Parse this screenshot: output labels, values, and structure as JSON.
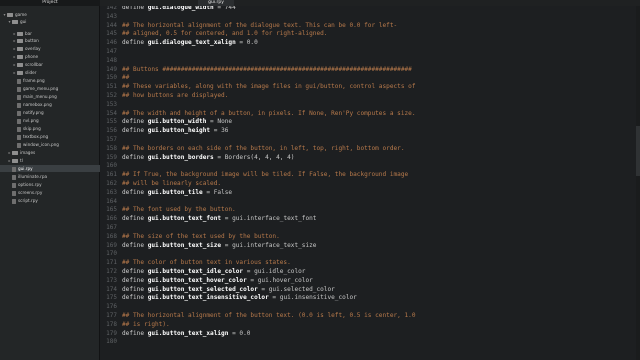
{
  "window": {
    "project_title": "Project",
    "active_tab": "gui.rpy"
  },
  "sidebar": {
    "items": [
      {
        "label": "game",
        "kind": "folder",
        "depth": 0,
        "expanded": true
      },
      {
        "label": "gui",
        "kind": "folder",
        "depth": 1,
        "expanded": true
      },
      {
        "label": "bar",
        "kind": "folder",
        "depth": 2,
        "expanded": false
      },
      {
        "label": "button",
        "kind": "folder",
        "depth": 2,
        "expanded": false
      },
      {
        "label": "overlay",
        "kind": "folder",
        "depth": 2,
        "expanded": false
      },
      {
        "label": "phone",
        "kind": "folder",
        "depth": 2,
        "expanded": false
      },
      {
        "label": "scrollbar",
        "kind": "folder",
        "depth": 2,
        "expanded": false
      },
      {
        "label": "slider",
        "kind": "folder",
        "depth": 2,
        "expanded": false
      },
      {
        "label": "frame.png",
        "kind": "file",
        "depth": 2
      },
      {
        "label": "game_menu.png",
        "kind": "file",
        "depth": 2
      },
      {
        "label": "main_menu.png",
        "kind": "file",
        "depth": 2
      },
      {
        "label": "namebox.png",
        "kind": "file",
        "depth": 2
      },
      {
        "label": "notify.png",
        "kind": "file",
        "depth": 2
      },
      {
        "label": "nvl.png",
        "kind": "file",
        "depth": 2
      },
      {
        "label": "skip.png",
        "kind": "file",
        "depth": 2
      },
      {
        "label": "textbox.png",
        "kind": "file",
        "depth": 2
      },
      {
        "label": "window_icon.png",
        "kind": "file",
        "depth": 2
      },
      {
        "label": "images",
        "kind": "folder",
        "depth": 1,
        "expanded": false
      },
      {
        "label": "tl",
        "kind": "folder",
        "depth": 1,
        "expanded": false
      },
      {
        "label": "gui.rpy",
        "kind": "file",
        "depth": 1,
        "selected": true
      },
      {
        "label": "illuminate.rpa",
        "kind": "file",
        "depth": 1
      },
      {
        "label": "options.rpy",
        "kind": "file",
        "depth": 1
      },
      {
        "label": "screens.rpy",
        "kind": "file",
        "depth": 1
      },
      {
        "label": "script.rpy",
        "kind": "file",
        "depth": 1
      }
    ]
  },
  "editor": {
    "lines": [
      {
        "n": "142",
        "text": "define gui.dialogue_width = 744"
      },
      {
        "n": "143",
        "text": ""
      },
      {
        "n": "144",
        "text": "## The horizontal alignment of the dialogue text. This can be 0.0 for left-"
      },
      {
        "n": "145",
        "text": "## aligned, 0.5 for centered, and 1.0 for right-aligned."
      },
      {
        "n": "146",
        "text": "define gui.dialogue_text_xalign = 0.0"
      },
      {
        "n": "147",
        "text": ""
      },
      {
        "n": "148",
        "text": ""
      },
      {
        "n": "149",
        "text": "## Buttons ####################################################################"
      },
      {
        "n": "150",
        "text": "##"
      },
      {
        "n": "151",
        "text": "## These variables, along with the image files in gui/button, control aspects of"
      },
      {
        "n": "152",
        "text": "## how buttons are displayed."
      },
      {
        "n": "153",
        "text": ""
      },
      {
        "n": "154",
        "text": "## The width and height of a button, in pixels. If None, Ren'Py computes a size."
      },
      {
        "n": "155",
        "text": "define gui.button_width = None"
      },
      {
        "n": "156",
        "text": "define gui.button_height = 36"
      },
      {
        "n": "157",
        "text": ""
      },
      {
        "n": "158",
        "text": "## The borders on each side of the button, in left, top, right, bottom order."
      },
      {
        "n": "159",
        "text": "define gui.button_borders = Borders(4, 4, 4, 4)"
      },
      {
        "n": "160",
        "text": ""
      },
      {
        "n": "161",
        "text": "## If True, the background image will be tiled. If False, the background image"
      },
      {
        "n": "162",
        "text": "## will be linearly scaled."
      },
      {
        "n": "163",
        "text": "define gui.button_tile = False"
      },
      {
        "n": "164",
        "text": ""
      },
      {
        "n": "165",
        "text": "## The font used by the button."
      },
      {
        "n": "166",
        "text": "define gui.button_text_font = gui.interface_text_font"
      },
      {
        "n": "167",
        "text": ""
      },
      {
        "n": "168",
        "text": "## The size of the text used by the button."
      },
      {
        "n": "169",
        "text": "define gui.button_text_size = gui.interface_text_size"
      },
      {
        "n": "170",
        "text": ""
      },
      {
        "n": "171",
        "text": "## The color of button text in various states."
      },
      {
        "n": "172",
        "text": "define gui.button_text_idle_color = gui.idle_color"
      },
      {
        "n": "173",
        "text": "define gui.button_text_hover_color = gui.hover_color"
      },
      {
        "n": "174",
        "text": "define gui.button_text_selected_color = gui.selected_color"
      },
      {
        "n": "175",
        "text": "define gui.button_text_insensitive_color = gui.insensitive_color"
      },
      {
        "n": "176",
        "text": ""
      },
      {
        "n": "177",
        "text": "## The horizontal alignment of the button text. (0.0 is left, 0.5 is center, 1.0"
      },
      {
        "n": "178",
        "text": "## is right)."
      },
      {
        "n": "179",
        "text": "define gui.button_text_xalign = 0.0"
      },
      {
        "n": "180",
        "text": ""
      }
    ]
  },
  "colors": {
    "comment": "#b87a4b",
    "background": "#1d1f21",
    "sidebar": "#232627"
  }
}
